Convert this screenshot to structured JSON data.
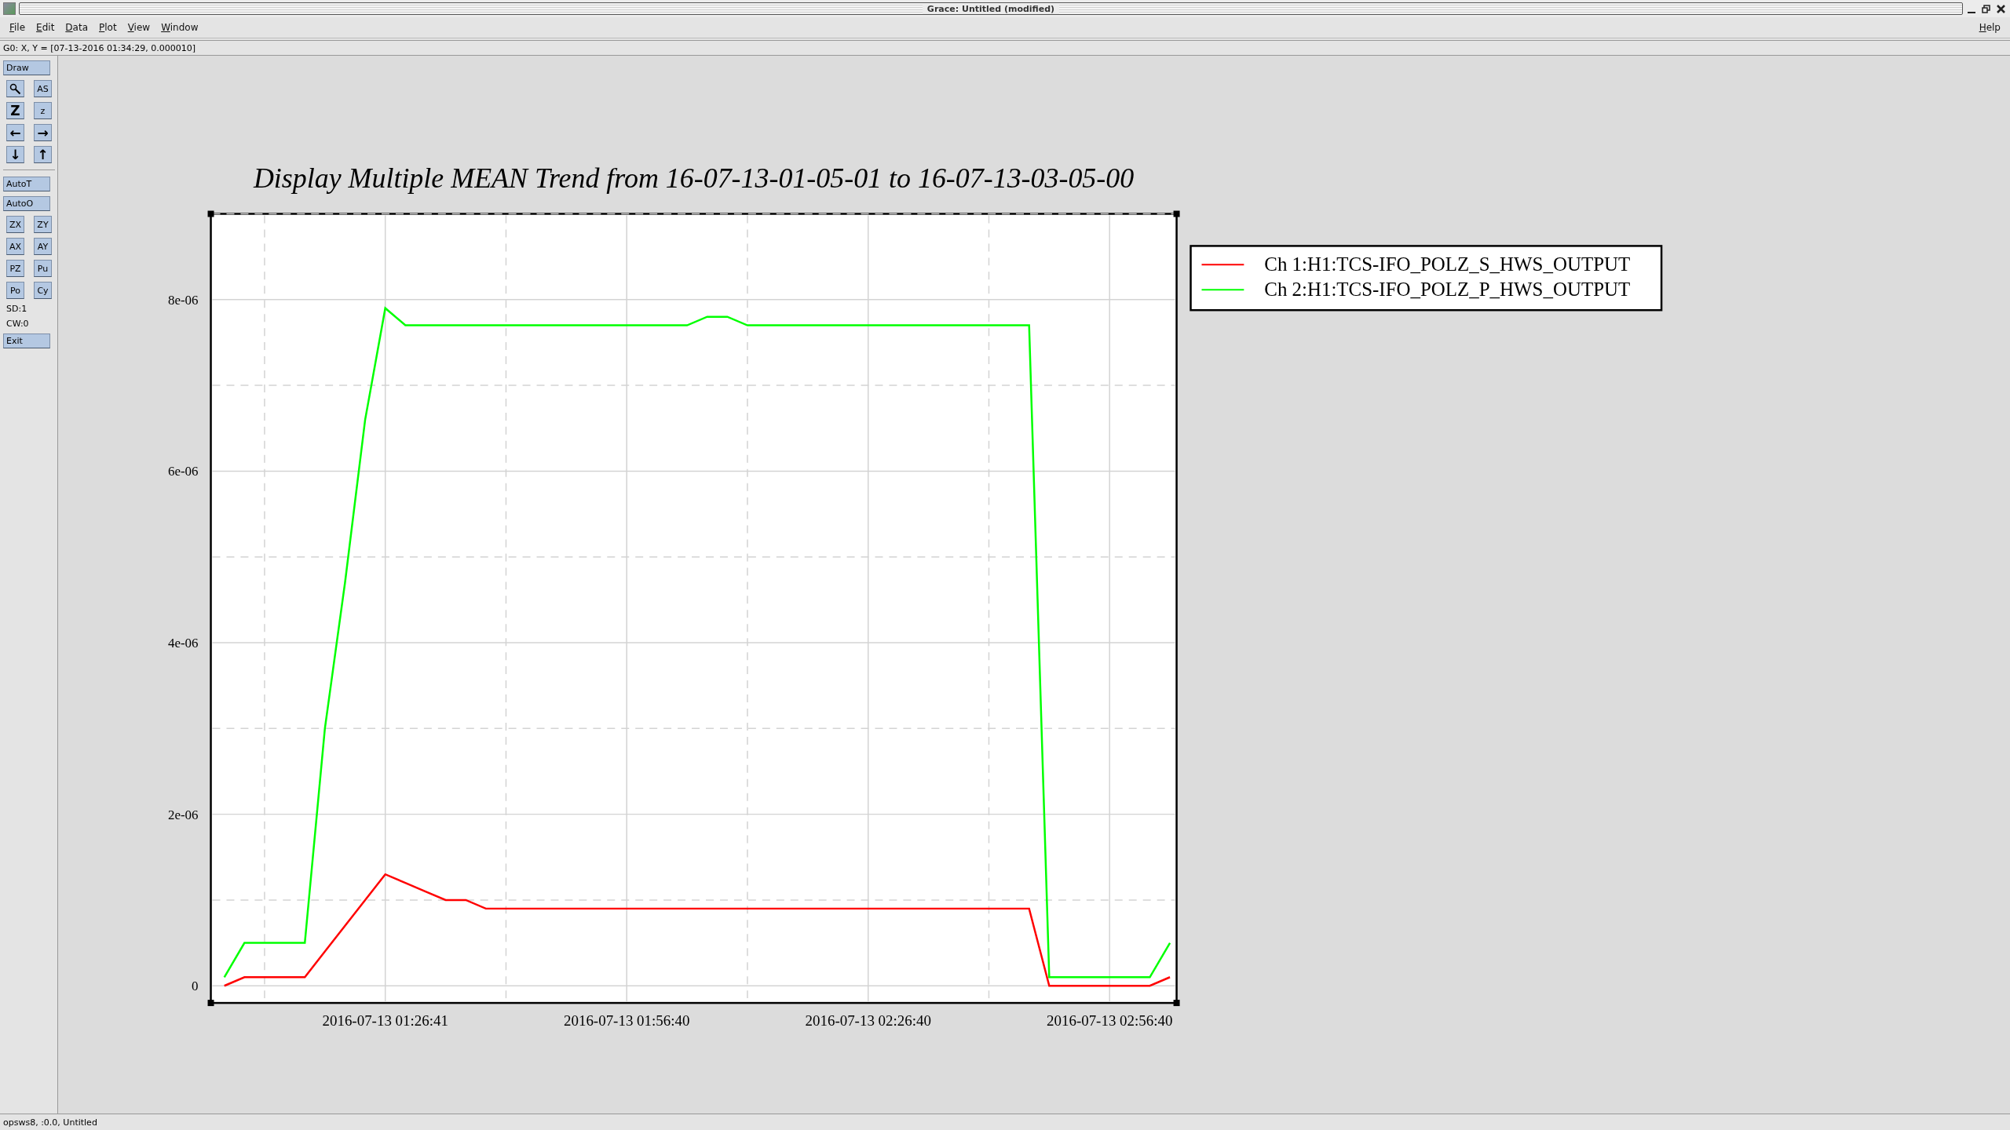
{
  "window": {
    "title": "Grace: Untitled (modified)"
  },
  "menu": [
    {
      "label": "File"
    },
    {
      "label": "Edit"
    },
    {
      "label": "Data"
    },
    {
      "label": "Plot"
    },
    {
      "label": "View"
    },
    {
      "label": "Window"
    }
  ],
  "help_menu": {
    "label": "Help"
  },
  "locator": "G0: X, Y = [07-13-2016 01:34:29, 0.000010]",
  "toolbar": [
    {
      "kind": "wide",
      "label": "Draw"
    },
    {
      "kind": "pair",
      "buttons": [
        {
          "kind": "magnifier"
        },
        {
          "kind": "text",
          "label": "AS"
        }
      ]
    },
    {
      "kind": "pair",
      "buttons": [
        {
          "kind": "big",
          "label": "Z"
        },
        {
          "kind": "text",
          "label": "z"
        }
      ]
    },
    {
      "kind": "pair",
      "buttons": [
        {
          "kind": "big",
          "label": "←"
        },
        {
          "kind": "big",
          "label": "→"
        }
      ]
    },
    {
      "kind": "pair",
      "buttons": [
        {
          "kind": "big",
          "label": "↓"
        },
        {
          "kind": "big",
          "label": "↑"
        }
      ]
    },
    {
      "kind": "separator"
    },
    {
      "kind": "wide",
      "label": "AutoT"
    },
    {
      "kind": "wide",
      "label": "AutoO"
    },
    {
      "kind": "pair",
      "buttons": [
        {
          "kind": "text",
          "label": "ZX"
        },
        {
          "kind": "text",
          "label": "ZY"
        }
      ]
    },
    {
      "kind": "pair",
      "buttons": [
        {
          "kind": "text",
          "label": "AX"
        },
        {
          "kind": "text",
          "label": "AY"
        }
      ]
    },
    {
      "kind": "pair",
      "buttons": [
        {
          "kind": "text",
          "label": "PZ"
        },
        {
          "kind": "text",
          "label": "Pu"
        }
      ]
    },
    {
      "kind": "pair",
      "buttons": [
        {
          "kind": "text",
          "label": "Po"
        },
        {
          "kind": "text",
          "label": "Cy"
        }
      ]
    },
    {
      "kind": "info",
      "label": "SD:1"
    },
    {
      "kind": "info",
      "label": "CW:0"
    },
    {
      "kind": "wide",
      "label": "Exit"
    }
  ],
  "plot": {
    "chart_data": {
      "type": "line",
      "title": "Display Multiple MEAN Trend from 16-07-13-01-05-01 to 16-07-13-03-05-00",
      "categories": [
        null,
        null,
        null,
        null,
        null,
        null,
        null,
        null,
        "2016-07-13 01:26:41",
        null,
        null,
        null,
        null,
        null,
        null,
        null,
        null,
        null,
        null,
        null,
        "2016-07-13 01:56:40",
        null,
        null,
        null,
        null,
        null,
        null,
        null,
        null,
        null,
        null,
        null,
        "2016-07-13 02:26:40",
        null,
        null,
        null,
        null,
        null,
        null,
        null,
        null,
        null,
        null,
        null,
        "2016-07-13 02:56:40",
        null,
        null,
        null
      ],
      "series": [
        {
          "name": "Ch 1:H1:TCS-IFO_POLZ_S_HWS_OUTPUT",
          "color": "#ff0000",
          "values": [
            0,
            1e-07,
            1e-07,
            1e-07,
            1e-07,
            4e-07,
            7e-07,
            1e-06,
            1.3e-06,
            1.2e-06,
            1.1e-06,
            1e-06,
            1e-06,
            9e-07,
            9e-07,
            9e-07,
            9e-07,
            9e-07,
            9e-07,
            9e-07,
            9e-07,
            9e-07,
            9e-07,
            9e-07,
            9e-07,
            9e-07,
            9e-07,
            9e-07,
            9e-07,
            9e-07,
            9e-07,
            9e-07,
            9e-07,
            9e-07,
            9e-07,
            9e-07,
            9e-07,
            9e-07,
            9e-07,
            9e-07,
            9e-07,
            0,
            0,
            0,
            0,
            0,
            0,
            1e-07
          ]
        },
        {
          "name": "Ch 2:H1:TCS-IFO_POLZ_P_HWS_OUTPUT",
          "color": "#00ff00",
          "values": [
            1e-07,
            5e-07,
            5e-07,
            5e-07,
            5e-07,
            3e-06,
            4.7e-06,
            6.6e-06,
            7.9e-06,
            7.7e-06,
            7.7e-06,
            7.7e-06,
            7.7e-06,
            7.7e-06,
            7.7e-06,
            7.7e-06,
            7.7e-06,
            7.7e-06,
            7.7e-06,
            7.7e-06,
            7.7e-06,
            7.7e-06,
            7.7e-06,
            7.7e-06,
            7.8e-06,
            7.8e-06,
            7.7e-06,
            7.7e-06,
            7.7e-06,
            7.7e-06,
            7.7e-06,
            7.7e-06,
            7.7e-06,
            7.7e-06,
            7.7e-06,
            7.7e-06,
            7.7e-06,
            7.7e-06,
            7.7e-06,
            7.7e-06,
            7.7e-06,
            1e-07,
            1e-07,
            1e-07,
            1e-07,
            1e-07,
            1e-07,
            5e-07
          ]
        }
      ],
      "ylim": [
        -2e-07,
        9e-06
      ],
      "grid": true,
      "legend": true,
      "yticks": [
        {
          "value": 0,
          "label": "0"
        },
        {
          "value": 2e-06,
          "label": "2e-06"
        },
        {
          "value": 4e-06,
          "label": "4e-06"
        },
        {
          "value": 6e-06,
          "label": "6e-06"
        },
        {
          "value": 8e-06,
          "label": "8e-06"
        }
      ]
    }
  },
  "status_bar": "opsws8, :0.0, Untitled"
}
